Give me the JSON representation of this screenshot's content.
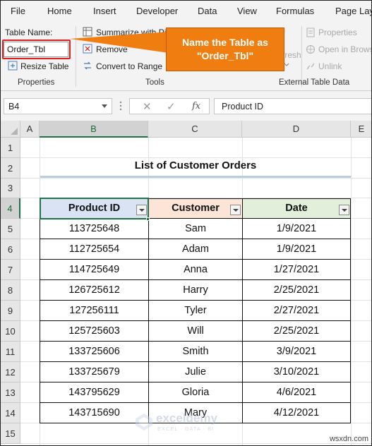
{
  "tabs": [
    "File",
    "Home",
    "Insert",
    "Developer",
    "Data",
    "View",
    "Formulas",
    "Page Lay"
  ],
  "ribbon": {
    "table_name_label": "Table Name:",
    "table_name_value": "Order_Tbl",
    "resize_table": "Resize Table",
    "summarize_pivot": "Summarize with Pi",
    "remove_duplicates": "Remove",
    "convert_to_range": "Convert to Range",
    "refresh": "fresh",
    "properties": "Properties",
    "open_in_browser": "Open in Brows",
    "unlink": "Unlink",
    "group_properties": "Properties",
    "group_tools": "Tools",
    "group_external": "External Table Data"
  },
  "callout": {
    "line1": "Name the Table as",
    "line2": "\"Order_Tbl\""
  },
  "formula_bar": {
    "name_box": "B4",
    "cancel_icon": "✕",
    "enter_icon": "✓",
    "fx_label": "fx",
    "content": "Product ID"
  },
  "sheet": {
    "columns": [
      "A",
      "B",
      "C",
      "D",
      "E"
    ],
    "rows": [
      "1",
      "2",
      "3",
      "4",
      "5",
      "6",
      "7",
      "8",
      "9",
      "10",
      "11",
      "12",
      "13",
      "14",
      "15"
    ],
    "selected_column": "B",
    "selected_row": "4"
  },
  "table": {
    "title": "List of Customer Orders",
    "headers": [
      "Product ID",
      "Customer",
      "Date"
    ],
    "header_colors": [
      "#dae3f3",
      "#fce4d6",
      "#e2efda"
    ],
    "rows": [
      [
        "113725648",
        "Sam",
        "1/9/2021"
      ],
      [
        "112725654",
        "Adam",
        "1/9/2021"
      ],
      [
        "114725649",
        "Anna",
        "1/27/2021"
      ],
      [
        "126725612",
        "Harry",
        "2/25/2021"
      ],
      [
        "127256111",
        "Tyler",
        "2/27/2021"
      ],
      [
        "125725603",
        "Will",
        "2/25/2021"
      ],
      [
        "133725606",
        "Smith",
        "3/9/2021"
      ],
      [
        "133725679",
        "Julie",
        "3/10/2021"
      ],
      [
        "143795629",
        "Gloria",
        "4/6/2021"
      ],
      [
        "143715690",
        "Mary",
        "4/12/2021"
      ]
    ]
  },
  "watermark": {
    "name": "exceldemy",
    "tagline": "EXCEL · DATA · BI"
  },
  "site_label": "wsxdn.com",
  "colors": {
    "excel_green": "#217346",
    "callout_orange": "#f07d10",
    "highlight_red": "#e02020"
  }
}
